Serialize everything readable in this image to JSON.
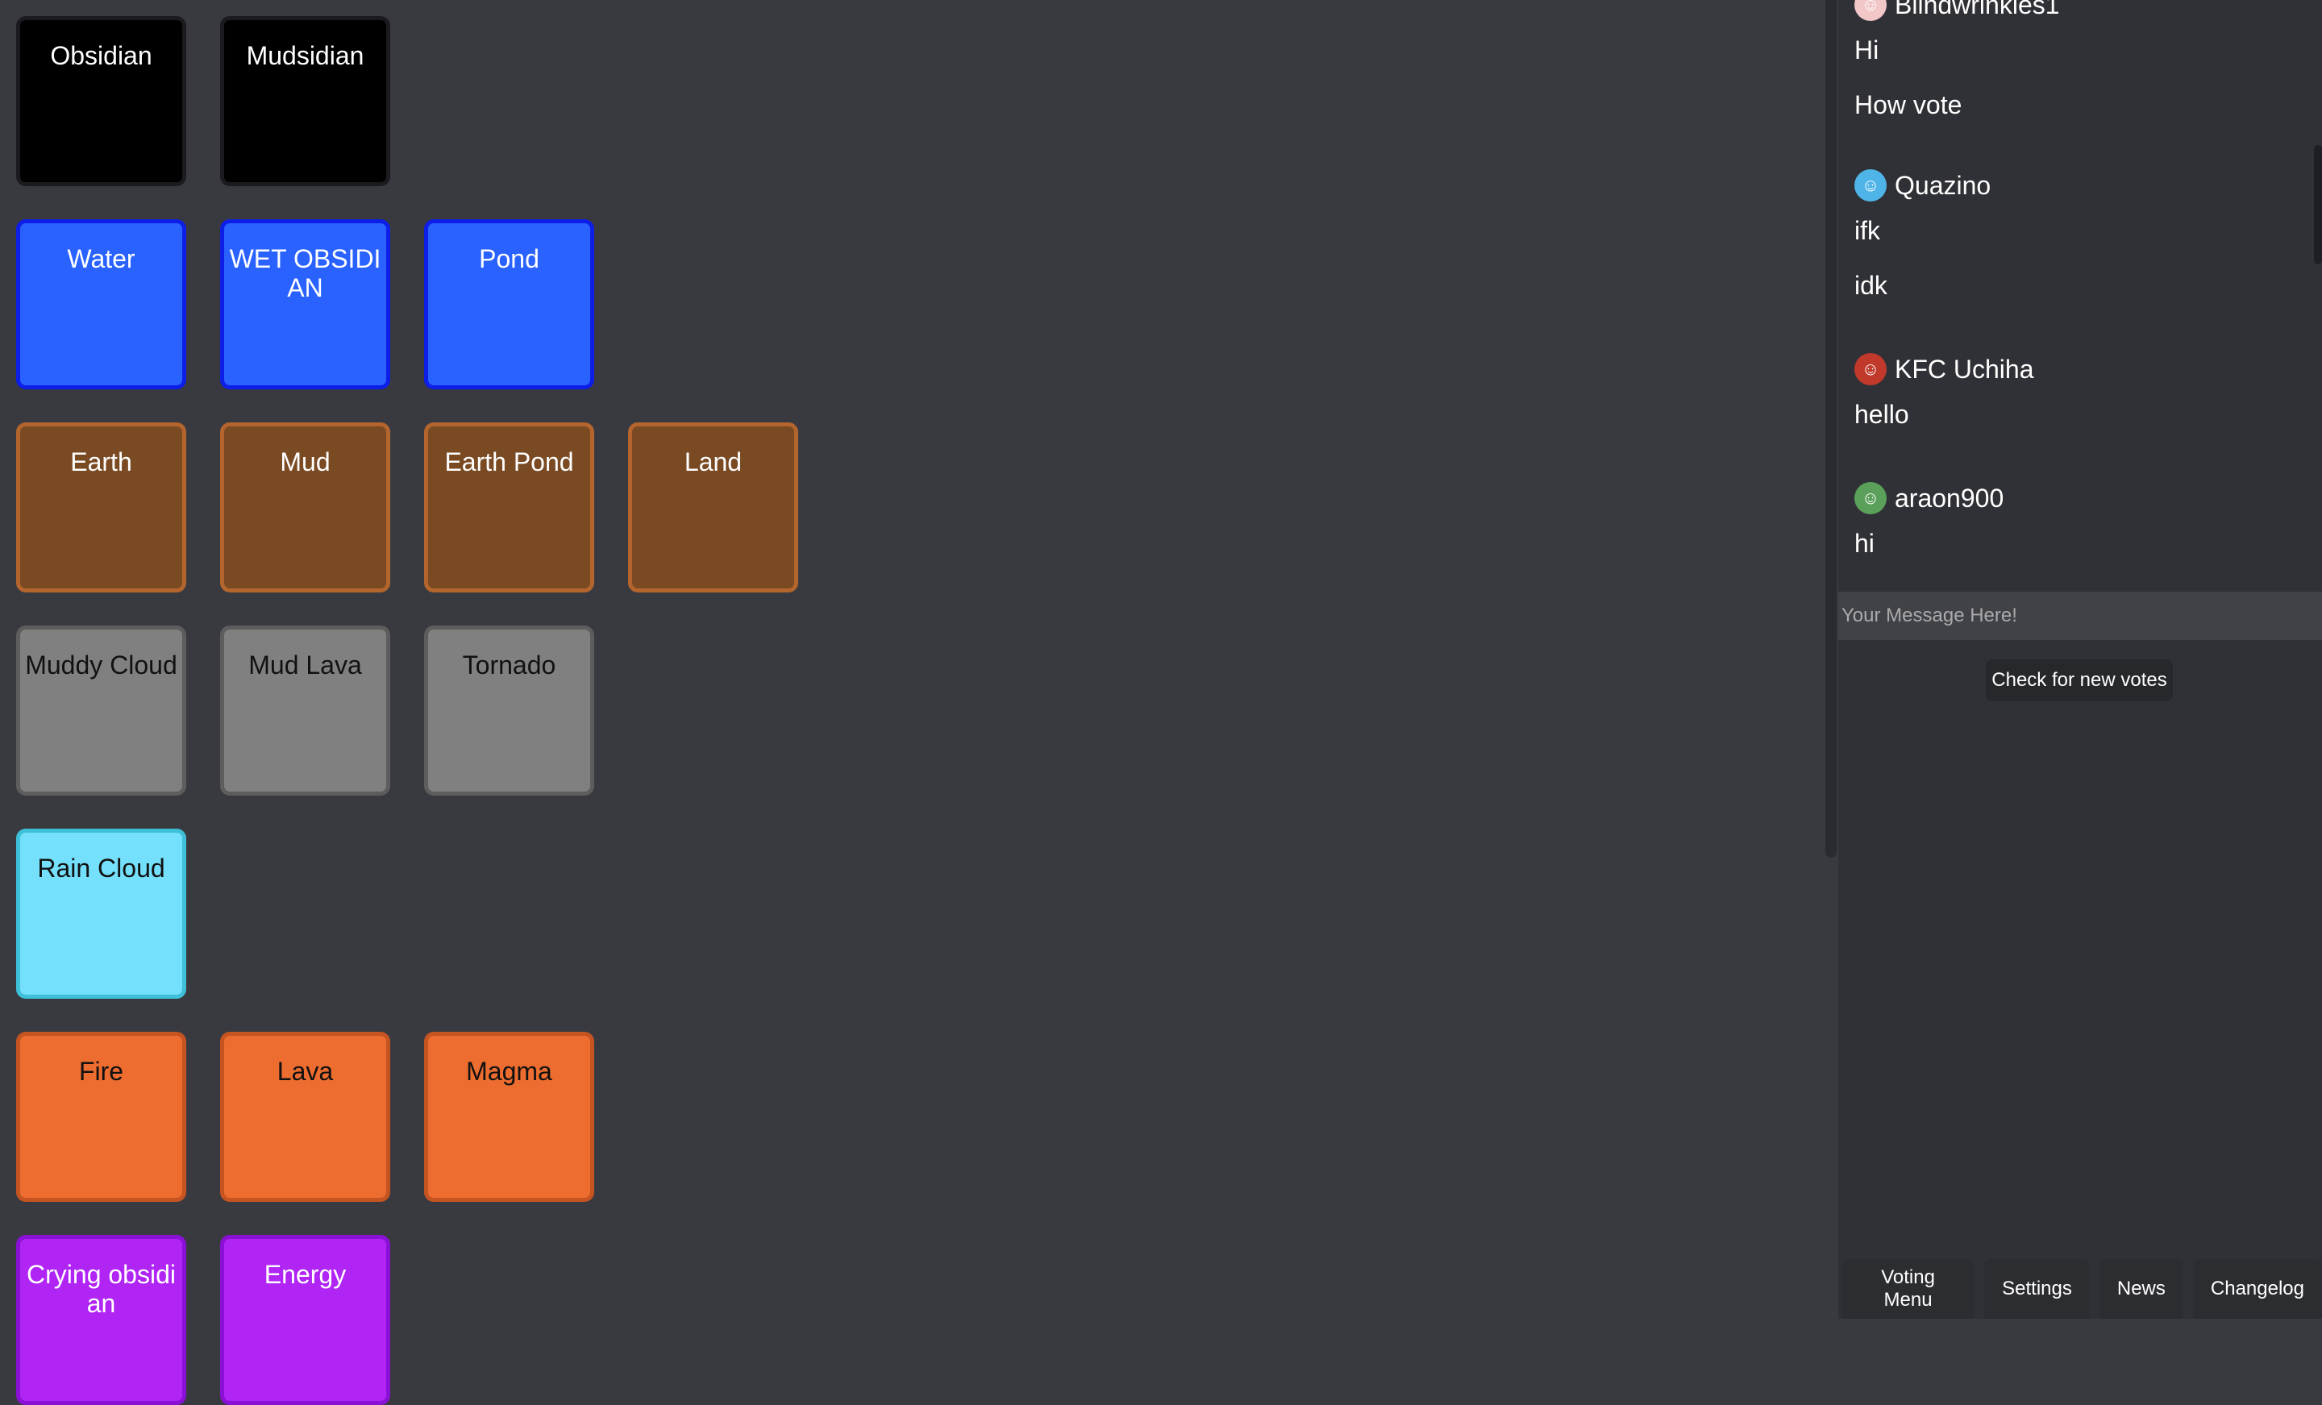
{
  "elements": [
    [
      {
        "label": "Obsidian",
        "color": "black"
      },
      {
        "label": "Mudsidian",
        "color": "black"
      }
    ],
    [
      {
        "label": "Water",
        "color": "blue"
      },
      {
        "label": "WET OBSIDIAN",
        "color": "blue"
      },
      {
        "label": "Pond",
        "color": "blue"
      }
    ],
    [
      {
        "label": "Earth",
        "color": "brown"
      },
      {
        "label": "Mud",
        "color": "brown"
      },
      {
        "label": "Earth Pond",
        "color": "brown"
      },
      {
        "label": "Land",
        "color": "brown"
      }
    ],
    [
      {
        "label": "Muddy Cloud",
        "color": "gray"
      },
      {
        "label": "Mud Lava",
        "color": "gray"
      },
      {
        "label": "Tornado",
        "color": "gray"
      }
    ],
    [
      {
        "label": "Rain Cloud",
        "color": "cyan"
      }
    ],
    [
      {
        "label": "Fire",
        "color": "orange"
      },
      {
        "label": "Lava",
        "color": "orange"
      },
      {
        "label": "Magma",
        "color": "orange"
      }
    ],
    [
      {
        "label": "Crying obsidian",
        "color": "purple"
      },
      {
        "label": "Energy",
        "color": "purple"
      }
    ]
  ],
  "chat": {
    "groups": [
      {
        "user": "Blindwrinkles1",
        "avatar_icon": "avatar-icon",
        "avatar_color": "#f2c7c7",
        "messages": [
          "Hi",
          "How vote"
        ]
      },
      {
        "user": "Quazino",
        "avatar_icon": "avatar-icon",
        "avatar_color": "#4fb4e8",
        "messages": [
          "ifk",
          "idk"
        ]
      },
      {
        "user": "KFC Uchiha",
        "avatar_icon": "avatar-icon",
        "avatar_color": "#c0392b",
        "messages": [
          "hello"
        ]
      },
      {
        "user": "araon900",
        "avatar_icon": "avatar-icon",
        "avatar_color": "#5aa05a",
        "messages": [
          "hi"
        ]
      }
    ],
    "input_placeholder": "Your Message Here!",
    "check_votes_label": "Check for new votes"
  },
  "menu": {
    "voting_label": "Voting Menu",
    "settings_label": "Settings",
    "news_label": "News",
    "changelog_label": "Changelog"
  }
}
